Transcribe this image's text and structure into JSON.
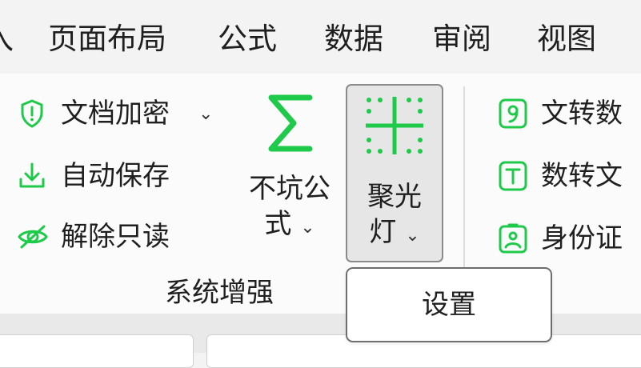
{
  "menu": {
    "partial_left": "入",
    "items": [
      "页面布局",
      "公式",
      "数据",
      "审阅",
      "视图"
    ]
  },
  "ribbon": {
    "security_group": {
      "encrypt": "文档加密",
      "autosave": "自动保存",
      "unlock_readonly": "解除只读"
    },
    "formula_button": {
      "line1": "不坑公",
      "line2": "式"
    },
    "spotlight_button": {
      "line1": "聚光",
      "line2": "灯"
    },
    "group_label": "系统增强",
    "convert_group": {
      "text_to_number": "文转数",
      "number_to_text": "数转文",
      "id_card": "身份证"
    }
  },
  "popup": {
    "settings": "设置"
  },
  "colors": {
    "accent_green": "#1fc94a",
    "ribbon_bg": "#fbfbfb",
    "menubar_bg": "#f3f3f3"
  },
  "icons": {
    "encrypt": "shield-exclamation-icon",
    "autosave": "download-icon",
    "unlock": "eye-off-icon",
    "formula": "sigma-icon",
    "spotlight": "crosshair-grid-icon",
    "text_to_number": "digit-nine-icon",
    "number_to_text": "letter-t-icon",
    "id_card": "id-card-icon"
  }
}
